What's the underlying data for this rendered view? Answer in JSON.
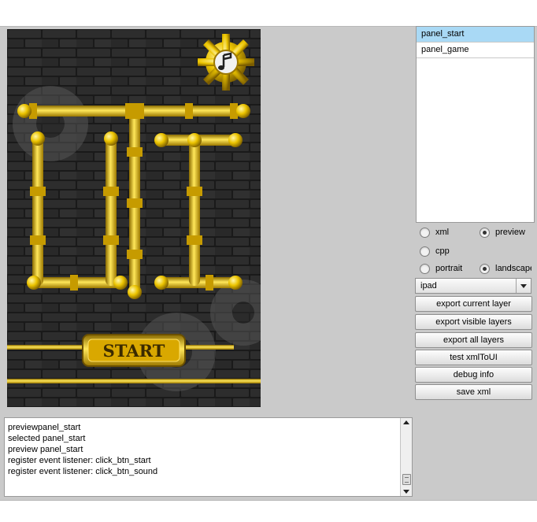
{
  "preview": {
    "start_button_label": "START",
    "sound_icon": "music-note-gear-icon"
  },
  "layers": {
    "items": [
      {
        "label": "panel_start",
        "selected": true
      },
      {
        "label": "panel_game",
        "selected": false
      }
    ]
  },
  "options": {
    "mode": {
      "xml": "xml",
      "preview": "preview",
      "cpp": "cpp",
      "selected": "preview"
    },
    "orientation": {
      "portrait": "portrait",
      "landscape": "landscape",
      "selected": "landscape"
    }
  },
  "device": {
    "selected": "ipad"
  },
  "actions": {
    "export_current": "export current layer",
    "export_visible": "export visible layers",
    "export_all": "export all layers",
    "test_xml": "test xmlToUI",
    "debug_info": "debug info",
    "save_xml": "save xml"
  },
  "console": {
    "lines": [
      "previewpanel_start",
      "selected panel_start",
      "preview panel_start",
      "register event listener: click_btn_start",
      "register event listener: click_btn_sound"
    ]
  },
  "colors": {
    "accent_selection": "#a9d9f5",
    "pipe_gold": "#e8c200",
    "brick_dark": "#1b1b1b",
    "workspace_gray": "#cacaca"
  }
}
